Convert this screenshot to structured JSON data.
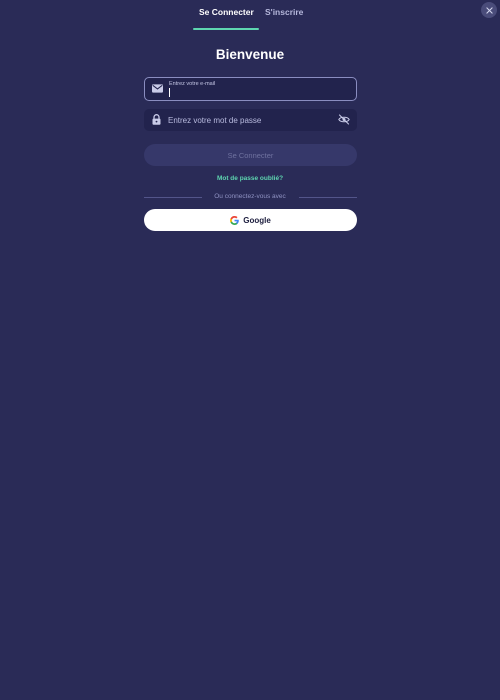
{
  "tabs": [
    {
      "label": "Se Connecter",
      "active": true
    },
    {
      "label": "S'inscrire",
      "active": false
    }
  ],
  "title": "Bienvenue",
  "email": {
    "label": "Entrez votre e-mail",
    "value": "",
    "icon": "envelope-icon"
  },
  "password": {
    "placeholder": "Entrez votre mot de passe",
    "value": "",
    "icon": "lock-icon",
    "toggle_icon": "eye-off-icon"
  },
  "login_button": {
    "label": "Se Connecter",
    "disabled": true
  },
  "forgot_password": "Mot de passe oublié?",
  "divider_text": "Ou connectez-vous avec",
  "google_button": {
    "label": "Google",
    "icon": "google-icon"
  },
  "close_icon": "close-icon",
  "colors": {
    "background": "#2a2b57",
    "field_background": "#22234d",
    "accent": "#5ed6b0",
    "button_disabled": "#36386a",
    "text_primary": "#ffffff"
  }
}
